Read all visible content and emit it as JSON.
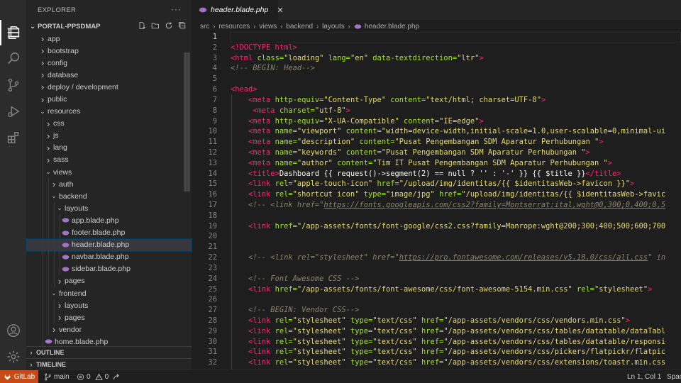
{
  "explorer": {
    "title": "EXPLORER",
    "more": "···",
    "project": "PORTAL-PPSDMAP",
    "outline": "OUTLINE",
    "timeline": "TIMELINE"
  },
  "tree": [
    {
      "label": "app",
      "depth": 0,
      "kind": "folder",
      "open": false
    },
    {
      "label": "bootstrap",
      "depth": 0,
      "kind": "folder",
      "open": false
    },
    {
      "label": "config",
      "depth": 0,
      "kind": "folder",
      "open": false
    },
    {
      "label": "database",
      "depth": 0,
      "kind": "folder",
      "open": false
    },
    {
      "label": "deploy / development",
      "depth": 0,
      "kind": "folder",
      "open": false
    },
    {
      "label": "public",
      "depth": 0,
      "kind": "folder",
      "open": false
    },
    {
      "label": "resources",
      "depth": 0,
      "kind": "folder",
      "open": true
    },
    {
      "label": "css",
      "depth": 1,
      "kind": "folder",
      "open": false
    },
    {
      "label": "js",
      "depth": 1,
      "kind": "folder",
      "open": false
    },
    {
      "label": "lang",
      "depth": 1,
      "kind": "folder",
      "open": false
    },
    {
      "label": "sass",
      "depth": 1,
      "kind": "folder",
      "open": false
    },
    {
      "label": "views",
      "depth": 1,
      "kind": "folder",
      "open": true
    },
    {
      "label": "auth",
      "depth": 2,
      "kind": "folder",
      "open": false
    },
    {
      "label": "backend",
      "depth": 2,
      "kind": "folder",
      "open": true
    },
    {
      "label": "layouts",
      "depth": 3,
      "kind": "folder",
      "open": true
    },
    {
      "label": "app.blade.php",
      "depth": 4,
      "kind": "file"
    },
    {
      "label": "footer.blade.php",
      "depth": 4,
      "kind": "file"
    },
    {
      "label": "header.blade.php",
      "depth": 4,
      "kind": "file",
      "selected": true
    },
    {
      "label": "navbar.blade.php",
      "depth": 4,
      "kind": "file"
    },
    {
      "label": "sidebar.blade.php",
      "depth": 4,
      "kind": "file"
    },
    {
      "label": "pages",
      "depth": 3,
      "kind": "folder",
      "open": false
    },
    {
      "label": "frontend",
      "depth": 2,
      "kind": "folder",
      "open": true
    },
    {
      "label": "layouts",
      "depth": 3,
      "kind": "folder",
      "open": false
    },
    {
      "label": "pages",
      "depth": 3,
      "kind": "folder",
      "open": false
    },
    {
      "label": "vendor",
      "depth": 2,
      "kind": "folder",
      "open": false
    },
    {
      "label": "home.blade.php",
      "depth": 1,
      "kind": "file"
    }
  ],
  "tab": {
    "label": "header.blade.php",
    "close": "✕"
  },
  "breadcrumb": [
    "src",
    "resources",
    "views",
    "backend",
    "layouts",
    "header.blade.php"
  ],
  "code": [
    [],
    [
      [
        "t",
        "<!DOCTYPE html>"
      ]
    ],
    [
      [
        "t",
        "<html "
      ],
      [
        "a",
        "class="
      ],
      [
        "s",
        "\"loading\" "
      ],
      [
        "a",
        "lang="
      ],
      [
        "s",
        "\"en\" "
      ],
      [
        "a",
        "data-textdirection="
      ],
      [
        "s",
        "\"ltr\""
      ],
      [
        "t",
        ">"
      ]
    ],
    [
      [
        "c",
        "<!-- BEGIN: Head-->"
      ]
    ],
    [],
    [
      [
        "t",
        "<head>"
      ]
    ],
    [
      [
        "p",
        "    "
      ],
      [
        "t",
        "<meta "
      ],
      [
        "a",
        "http-equiv="
      ],
      [
        "s",
        "\"Content-Type\" "
      ],
      [
        "a",
        "content="
      ],
      [
        "s",
        "\"text/html; charset=UTF-8\""
      ],
      [
        "t",
        ">"
      ]
    ],
    [
      [
        "p",
        "     "
      ],
      [
        "t",
        "<meta "
      ],
      [
        "a",
        "charset="
      ],
      [
        "s",
        "\"utf-8\""
      ],
      [
        "t",
        ">"
      ]
    ],
    [
      [
        "p",
        "    "
      ],
      [
        "t",
        "<meta "
      ],
      [
        "a",
        "http-equiv="
      ],
      [
        "s",
        "\"X-UA-Compatible\" "
      ],
      [
        "a",
        "content="
      ],
      [
        "s",
        "\"IE=edge\""
      ],
      [
        "t",
        ">"
      ]
    ],
    [
      [
        "p",
        "    "
      ],
      [
        "t",
        "<meta "
      ],
      [
        "a",
        "name="
      ],
      [
        "s",
        "\"viewport\" "
      ],
      [
        "a",
        "content="
      ],
      [
        "s",
        "\"width=device-width,initial-scale=1.0,user-scalable=0,minimal-ui"
      ]
    ],
    [
      [
        "p",
        "    "
      ],
      [
        "t",
        "<meta "
      ],
      [
        "a",
        "name="
      ],
      [
        "s",
        "\"description\" "
      ],
      [
        "a",
        "content="
      ],
      [
        "s",
        "\"Pusat Pengembangan SDM Aparatur Perhubungan \""
      ],
      [
        "t",
        ">"
      ]
    ],
    [
      [
        "p",
        "    "
      ],
      [
        "t",
        "<meta "
      ],
      [
        "a",
        "name="
      ],
      [
        "s",
        "\"keywords\" "
      ],
      [
        "a",
        "content="
      ],
      [
        "s",
        "\"Pusat Pengembangan SDM Aparatur Perhubungan \""
      ],
      [
        "t",
        ">"
      ]
    ],
    [
      [
        "p",
        "    "
      ],
      [
        "t",
        "<meta "
      ],
      [
        "a",
        "name="
      ],
      [
        "s",
        "\"author\" "
      ],
      [
        "a",
        "content="
      ],
      [
        "s",
        "\"Tim IT Pusat Pengembangan SDM Aparatur Perhubungan \""
      ],
      [
        "t",
        ">"
      ]
    ],
    [
      [
        "p",
        "    "
      ],
      [
        "t",
        "<title>"
      ],
      [
        "x",
        "Dashboard {{ request()->segment(2) == null ? '' : '-' }} {{ $title }}"
      ],
      [
        "t",
        "</title>"
      ]
    ],
    [
      [
        "p",
        "    "
      ],
      [
        "t",
        "<link "
      ],
      [
        "a",
        "rel="
      ],
      [
        "s",
        "\"apple-touch-icon\" "
      ],
      [
        "a",
        "href="
      ],
      [
        "s",
        "\"/upload/img/identitas/{{ $identitasWeb->favicon }}\""
      ],
      [
        "t",
        ">"
      ]
    ],
    [
      [
        "p",
        "    "
      ],
      [
        "t",
        "<link "
      ],
      [
        "a",
        "rel="
      ],
      [
        "s",
        "\"shortcut icon\" "
      ],
      [
        "a",
        "type="
      ],
      [
        "s",
        "\"image/jpg\" "
      ],
      [
        "a",
        "href="
      ],
      [
        "s",
        "\"/upload/img/identitas/{{ $identitasWeb->favic"
      ]
    ],
    [
      [
        "p",
        "    "
      ],
      [
        "c",
        "<!-- <link href=\""
      ],
      [
        "u",
        "https://fonts.googleapis.com/css2?family=Montserrat:ital,wght@0,300;0,400;0,5"
      ]
    ],
    [],
    [
      [
        "p",
        "    "
      ],
      [
        "t",
        "<link "
      ],
      [
        "a",
        "href="
      ],
      [
        "s",
        "\"/app-assets/fonts/font-google/css2.css?family=Manrope:wght@200;300;400;500;600;700"
      ]
    ],
    [],
    [],
    [
      [
        "p",
        "    "
      ],
      [
        "c",
        "<!-- <link rel=\"stylesheet\" href=\""
      ],
      [
        "u",
        "https://pro.fontawesome.com/releases/v5.10.0/css/all.css"
      ],
      [
        "c",
        "\" in"
      ]
    ],
    [],
    [
      [
        "p",
        "    "
      ],
      [
        "c",
        "<!-- Font Awesome CSS -->"
      ]
    ],
    [
      [
        "p",
        "    "
      ],
      [
        "t",
        "<link "
      ],
      [
        "a",
        "href="
      ],
      [
        "s",
        "\"/app-assets/fonts/font-awesome/css/font-awesome-5154.min.css\" "
      ],
      [
        "a",
        "rel="
      ],
      [
        "s",
        "\"stylesheet\""
      ],
      [
        "t",
        ">"
      ]
    ],
    [],
    [
      [
        "p",
        "    "
      ],
      [
        "c",
        "<!-- BEGIN: Vendor CSS-->"
      ]
    ],
    [
      [
        "p",
        "    "
      ],
      [
        "t",
        "<link "
      ],
      [
        "a",
        "rel="
      ],
      [
        "s",
        "\"stylesheet\" "
      ],
      [
        "a",
        "type="
      ],
      [
        "s",
        "\"text/css\" "
      ],
      [
        "a",
        "href="
      ],
      [
        "s",
        "\"/app-assets/vendors/css/vendors.min.css\""
      ],
      [
        "t",
        ">"
      ]
    ],
    [
      [
        "p",
        "    "
      ],
      [
        "t",
        "<link "
      ],
      [
        "a",
        "rel="
      ],
      [
        "s",
        "\"stylesheet\" "
      ],
      [
        "a",
        "type="
      ],
      [
        "s",
        "\"text/css\" "
      ],
      [
        "a",
        "href="
      ],
      [
        "s",
        "\"/app-assets/vendors/css/tables/datatable/dataTabl"
      ]
    ],
    [
      [
        "p",
        "    "
      ],
      [
        "t",
        "<link "
      ],
      [
        "a",
        "rel="
      ],
      [
        "s",
        "\"stylesheet\" "
      ],
      [
        "a",
        "type="
      ],
      [
        "s",
        "\"text/css\" "
      ],
      [
        "a",
        "href="
      ],
      [
        "s",
        "\"/app-assets/vendors/css/tables/datatable/responsi"
      ]
    ],
    [
      [
        "p",
        "    "
      ],
      [
        "t",
        "<link "
      ],
      [
        "a",
        "rel="
      ],
      [
        "s",
        "\"stylesheet\" "
      ],
      [
        "a",
        "type="
      ],
      [
        "s",
        "\"text/css\" "
      ],
      [
        "a",
        "href="
      ],
      [
        "s",
        "\"/app-assets/vendors/css/pickers/flatpickr/flatpic"
      ]
    ],
    [
      [
        "p",
        "    "
      ],
      [
        "t",
        "<link "
      ],
      [
        "a",
        "rel="
      ],
      [
        "s",
        "\"stylesheet\" "
      ],
      [
        "a",
        "type="
      ],
      [
        "s",
        "\"text/css\" "
      ],
      [
        "a",
        "href="
      ],
      [
        "s",
        "\"/app-assets/vendors/css/extensions/toastr.min.css"
      ]
    ],
    [
      [
        "p",
        "    "
      ],
      [
        "t",
        "<link "
      ],
      [
        "a",
        "rel="
      ],
      [
        "s",
        "\"stylesheet\" "
      ],
      [
        "a",
        "type="
      ],
      [
        "s",
        "\"text/css\" "
      ],
      [
        "a",
        "href="
      ],
      [
        "s",
        "\"/app-assets/vendors/css/editors/quill/katex.min.c"
      ]
    ]
  ],
  "status": {
    "gitlab": "GitLab",
    "branch": "main",
    "errors": "0",
    "warnings": "0",
    "position": "Ln 1, Col 1",
    "spaces": "Spac"
  },
  "colors": {
    "tag": "#f92672",
    "attribute": "#a6e22e",
    "string": "#e6db74",
    "comment": "#88846f",
    "gitlab": "#c74b16"
  }
}
